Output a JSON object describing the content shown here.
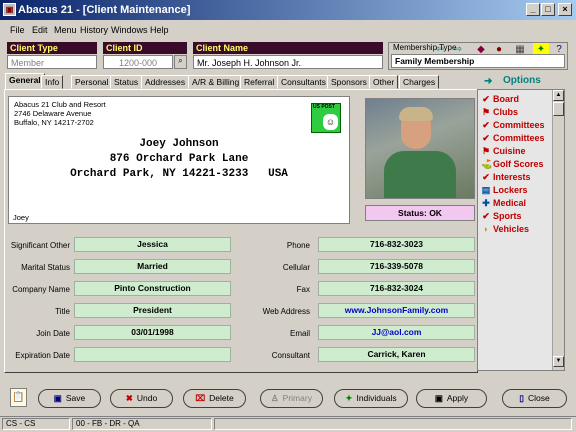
{
  "window": {
    "title": "Abacus 21 - [Client Maintenance]",
    "minimize": "_",
    "maximize": "□",
    "close": "×"
  },
  "menu": [
    "File",
    "Edit",
    "Menu",
    "History",
    "Windows",
    "Help"
  ],
  "header": {
    "client_type_label": "Client Type",
    "client_type_value": "Member",
    "client_id_label": "Client ID",
    "client_id_value": "1200-000",
    "client_name_label": "Client Name",
    "client_name_value": "Mr. Joseph H. Johnson Jr.",
    "membership_type_label": "Membership Type",
    "membership_type_value": "Family Membership"
  },
  "tabs": [
    "General",
    "Info",
    "Personal",
    "Status",
    "Addresses",
    "A/R & Billing",
    "Referral",
    "Consultants",
    "Sponsors",
    "Other",
    "Charges"
  ],
  "options_title": "Options",
  "address": {
    "org_line1": "Abacus 21 Club and Resort",
    "org_line2": "2746 Delaware Avenue",
    "org_line3": "Buffalo, NY 14217-2702",
    "stamp_text": "US POST",
    "name": "Joey Johnson",
    "street": "876 Orchard Park Lane",
    "city": "Orchard Park, NY 14221-3233",
    "country": "USA",
    "nickname": "Joey"
  },
  "status": "Status: OK",
  "fields_left": [
    {
      "label": "Significant Other",
      "value": "Jessica"
    },
    {
      "label": "Marital Status",
      "value": "Married"
    },
    {
      "label": "Company Name",
      "value": "Pinto Construction"
    },
    {
      "label": "Title",
      "value": "President"
    },
    {
      "label": "Join Date",
      "value": "03/01/1998"
    },
    {
      "label": "Expiration Date",
      "value": ""
    }
  ],
  "fields_right": [
    {
      "label": "Phone",
      "value": "716-832-3023"
    },
    {
      "label": "Cellular",
      "value": "716-339-5078"
    },
    {
      "label": "Fax",
      "value": "716-832-3024"
    },
    {
      "label": "Web Address",
      "value": "www.JohnsonFamily.com"
    },
    {
      "label": "Email",
      "value": "JJ@aol.com"
    },
    {
      "label": "Consultant",
      "value": "Carrick, Karen"
    }
  ],
  "options": [
    {
      "label": "Board",
      "icon": "check-icon"
    },
    {
      "label": "Clubs",
      "icon": "flag-icon"
    },
    {
      "label": "Committees",
      "icon": "check-icon"
    },
    {
      "label": "Committees",
      "icon": "check-icon"
    },
    {
      "label": "Cuisine",
      "icon": "flag-icon"
    },
    {
      "label": "Golf Scores",
      "icon": "golf-icon"
    },
    {
      "label": "Interests",
      "icon": "check-icon"
    },
    {
      "label": "Lockers",
      "icon": "locker-icon"
    },
    {
      "label": "Medical",
      "icon": "medical-icon"
    },
    {
      "label": "Sports",
      "icon": "check-icon"
    },
    {
      "label": "Vehicles",
      "icon": "car-icon"
    }
  ],
  "buttons": {
    "save": "Save",
    "undo": "Undo",
    "delete": "Delete",
    "primary": "Primary",
    "individuals": "Individuals",
    "apply": "Apply",
    "close": "Close"
  },
  "statusbar": {
    "left": "CS - CS",
    "middle": "00 - FB - DR - QA"
  },
  "colors": {
    "field_bg": "#cfeccf",
    "header_label_bg": "#3a0a2a",
    "header_label_fg": "#ffff66",
    "options_text": "#c00000",
    "link": "#0000cc"
  }
}
